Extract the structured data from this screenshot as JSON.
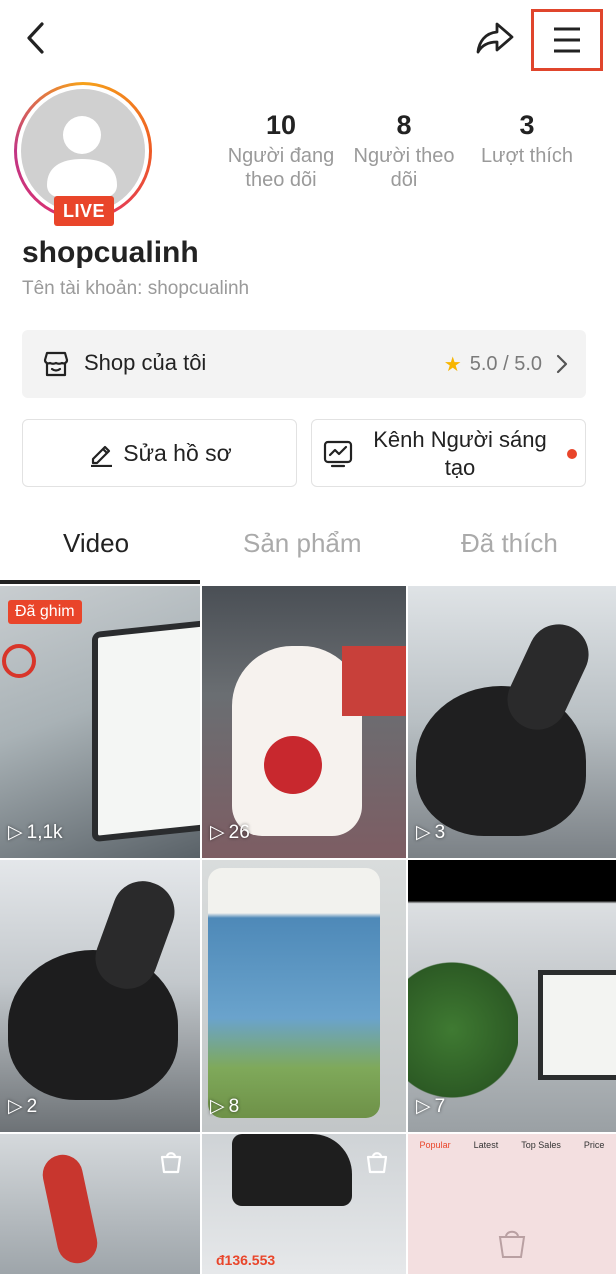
{
  "profile": {
    "username": "shopcualinh",
    "account_label": "Tên tài khoản: shopcualinh",
    "live_badge": "LIVE"
  },
  "stats": [
    {
      "value": "10",
      "label_line1": "Người đang",
      "label_line2": "theo dõi"
    },
    {
      "value": "8",
      "label_line1": "Người theo",
      "label_line2": "dõi"
    },
    {
      "value": "3",
      "label_line1": "Lượt thích",
      "label_line2": ""
    }
  ],
  "shop": {
    "label": "Shop của tôi",
    "rating": "5.0 / 5.0"
  },
  "buttons": {
    "edit_profile": "Sửa hồ sơ",
    "creator_channel": "Kênh Người sáng tạo"
  },
  "tabs": [
    "Video",
    "Sản phẩm",
    "Đã thích"
  ],
  "videos": [
    {
      "plays": "1,1k",
      "pinned": "Đã ghim"
    },
    {
      "plays": "26"
    },
    {
      "plays": "3"
    },
    {
      "plays": "2"
    },
    {
      "plays": "8"
    },
    {
      "plays": "7"
    }
  ],
  "products": [
    {
      "price": ""
    },
    {
      "price": "đ136.553"
    },
    {
      "menu": [
        "Popular",
        "Latest",
        "Top Sales",
        "Price"
      ]
    }
  ],
  "icons": {
    "back": "chevron-left-icon",
    "share": "share-icon",
    "menu": "hamburger-menu-icon",
    "shop": "store-icon",
    "edit": "pencil-icon",
    "creator": "analytics-icon",
    "play": "play-icon",
    "bag": "shopping-bag-icon"
  },
  "colors": {
    "accent": "#e9452a",
    "star": "#f7b500",
    "muted_text": "#9a9a9a"
  }
}
